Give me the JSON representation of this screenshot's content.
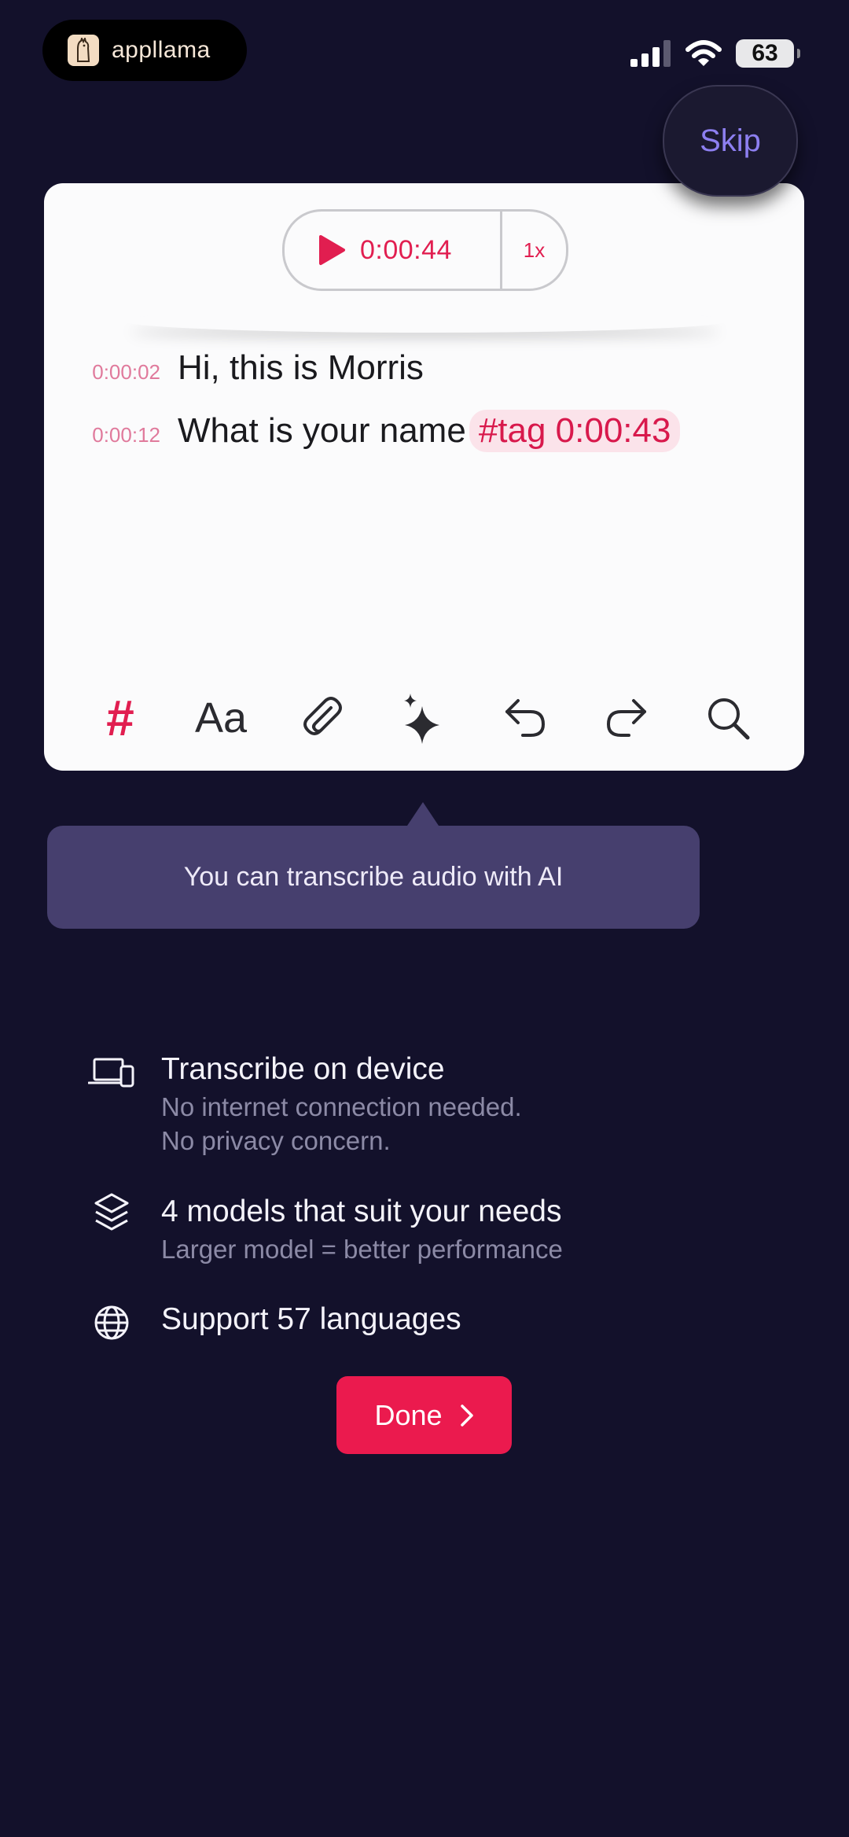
{
  "status_bar": {
    "brand": "appllama",
    "battery": "63"
  },
  "skip_label": "Skip",
  "player": {
    "time": "0:00:44",
    "speed": "1x"
  },
  "transcript": [
    {
      "timestamp": "0:00:02",
      "text": "Hi, this is Morris"
    },
    {
      "timestamp": "0:00:12",
      "text": "What is your name",
      "tag": "#tag 0:00:43"
    }
  ],
  "toolbar": {
    "tag_icon": "hashtag-icon",
    "format_label": "Aa",
    "attach_icon": "paperclip-icon",
    "ai_icon": "sparkles-icon",
    "undo_icon": "undo-icon",
    "redo_icon": "redo-icon",
    "search_icon": "search-icon"
  },
  "tooltip": "You can transcribe audio with AI",
  "features": [
    {
      "icon": "devices-icon",
      "title": "Transcribe on device",
      "lines": [
        "No internet connection needed.",
        "No privacy concern."
      ]
    },
    {
      "icon": "layers-icon",
      "title": "4 models that suit your needs",
      "lines": [
        "Larger model = better performance"
      ]
    },
    {
      "icon": "globe-icon",
      "title": "Support 57 languages",
      "lines": []
    }
  ],
  "done_label": "Done",
  "colors": {
    "background": "#13112b",
    "accent": "#eb1a4e",
    "tooltip": "#463f6e",
    "skip_text": "#8d7ff0"
  }
}
